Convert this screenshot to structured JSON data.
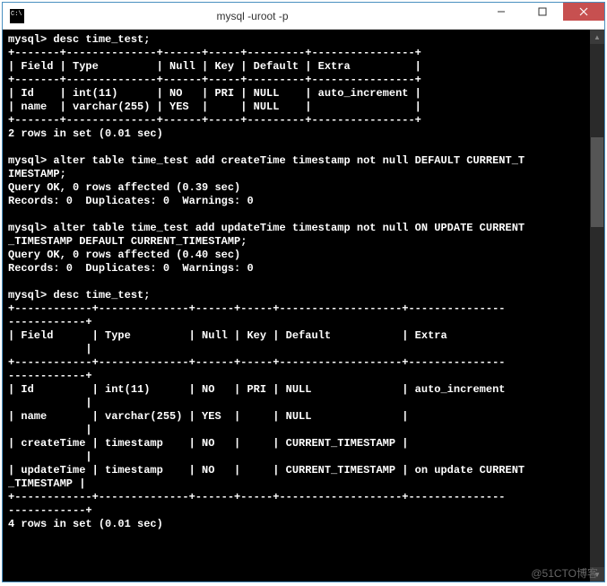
{
  "window": {
    "title": "mysql  -uroot -p"
  },
  "terminal": {
    "line01": "mysql> desc time_test;",
    "line02": "+-------+--------------+------+-----+---------+----------------+",
    "line03": "| Field | Type         | Null | Key | Default | Extra          |",
    "line04": "+-------+--------------+------+-----+---------+----------------+",
    "line05": "| Id    | int(11)      | NO   | PRI | NULL    | auto_increment |",
    "line06": "| name  | varchar(255) | YES  |     | NULL    |                |",
    "line07": "+-------+--------------+------+-----+---------+----------------+",
    "line08": "2 rows in set (0.01 sec)",
    "line09": "",
    "line10": "mysql> alter table time_test add createTime timestamp not null DEFAULT CURRENT_T",
    "line11": "IMESTAMP;",
    "line12": "Query OK, 0 rows affected (0.39 sec)",
    "line13": "Records: 0  Duplicates: 0  Warnings: 0",
    "line14": "",
    "line15": "mysql> alter table time_test add updateTime timestamp not null ON UPDATE CURRENT",
    "line16": "_TIMESTAMP DEFAULT CURRENT_TIMESTAMP;",
    "line17": "Query OK, 0 rows affected (0.40 sec)",
    "line18": "Records: 0  Duplicates: 0  Warnings: 0",
    "line19": "",
    "line20": "mysql> desc time_test;",
    "line21": "+------------+--------------+------+-----+-------------------+---------------",
    "line22": "------------+",
    "line23": "| Field      | Type         | Null | Key | Default           | Extra",
    "line24": "            |",
    "line25": "+------------+--------------+------+-----+-------------------+---------------",
    "line26": "------------+",
    "line27": "| Id         | int(11)      | NO   | PRI | NULL              | auto_increment",
    "line28": "            |",
    "line29": "| name       | varchar(255) | YES  |     | NULL              |",
    "line30": "            |",
    "line31": "| createTime | timestamp    | NO   |     | CURRENT_TIMESTAMP |",
    "line32": "            |",
    "line33": "| updateTime | timestamp    | NO   |     | CURRENT_TIMESTAMP | on update CURRENT",
    "line34": "_TIMESTAMP |",
    "line35": "+------------+--------------+------+-----+-------------------+---------------",
    "line36": "------------+",
    "line37": "4 rows in set (0.01 sec)"
  },
  "watermark": "@51CTO博客"
}
